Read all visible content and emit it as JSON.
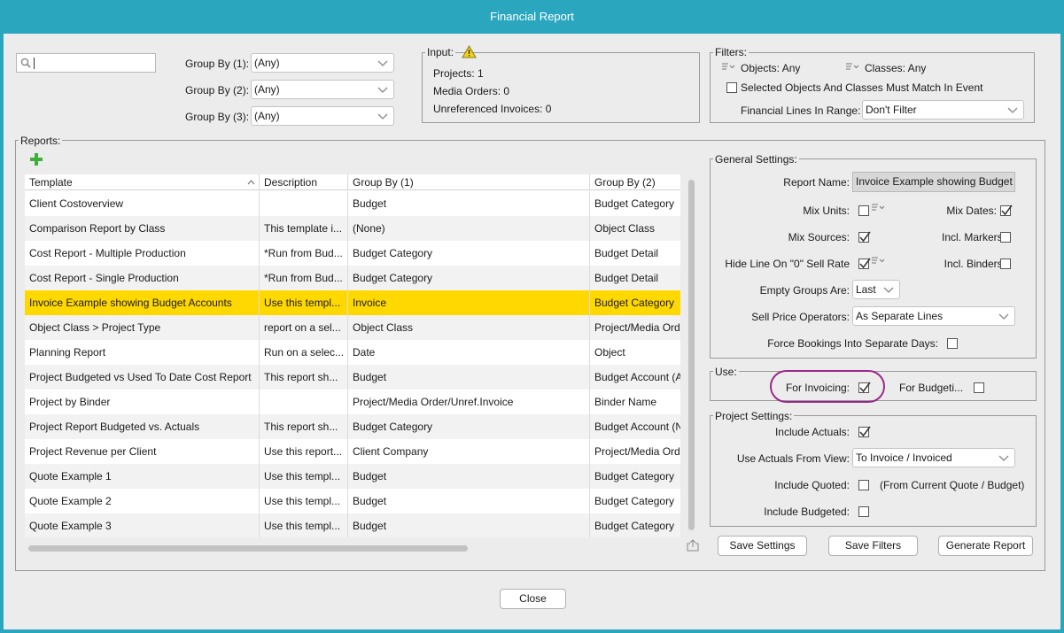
{
  "window": {
    "title": "Financial Report"
  },
  "search": {
    "value": ""
  },
  "group_by": [
    {
      "label": "Group By (1):",
      "value": "(Any)"
    },
    {
      "label": "Group By (2):",
      "value": "(Any)"
    },
    {
      "label": "Group By (3):",
      "value": "(Any)"
    }
  ],
  "input": {
    "title": "Input:",
    "warning_icon": "warning-triangle-icon",
    "projects": "Projects: 1",
    "media_orders": "Media Orders: 0",
    "unreferenced_invoices": "Unreferenced Invoices: 0"
  },
  "filters": {
    "title": "Filters:",
    "objects": "Objects: Any",
    "classes": "Classes: Any",
    "match_label": "Selected Objects And Classes Must Match In Event",
    "match_checked": false,
    "range_label": "Financial Lines In Range:",
    "range_value": "Don't Filter"
  },
  "reports": {
    "title": "Reports:",
    "add_icon": "plus-icon",
    "columns": [
      "Template",
      "Description",
      "Group By (1)",
      "Group By (2)"
    ],
    "rows": [
      [
        "Client Costoverview",
        "",
        "Budget",
        "Budget Category"
      ],
      [
        "Comparison Report by Class",
        "This template i...",
        "(None)",
        "Object Class"
      ],
      [
        "Cost Report - Multiple Production",
        "*Run from Bud...",
        "Budget Category",
        "Budget Detail"
      ],
      [
        "Cost Report - Single Production",
        "*Run from Bud...",
        "Budget Category",
        "Budget Detail"
      ],
      [
        "Invoice Example showing Budget Accounts",
        "Use this templ...",
        "Invoice",
        "Budget Category"
      ],
      [
        "Object Class > Project Type",
        "report on a sel...",
        "Object Class",
        "Project/Media Ord"
      ],
      [
        "Planning Report",
        "Run on a selec...",
        "Date",
        "Object"
      ],
      [
        "Project Budgeted vs Used To Date Cost Report",
        "This report sh...",
        "Budget",
        "Budget Account (A"
      ],
      [
        "Project by Binder",
        "",
        "Project/Media Order/Unref.Invoice",
        "Binder Name"
      ],
      [
        "Project Report Budgeted vs. Actuals",
        "This report sh...",
        "Budget Category",
        "Budget Account (N"
      ],
      [
        "Project Revenue per Client",
        "Use this report...",
        "Client Company",
        "Project/Media Ord"
      ],
      [
        "Quote Example 1",
        "Use this templ...",
        "Budget",
        "Budget Category"
      ],
      [
        "Quote Example 2",
        "Use this templ...",
        "Budget",
        "Budget Category"
      ],
      [
        "Quote Example 3",
        "Use this templ...",
        "Budget",
        "Budget Category"
      ]
    ],
    "selected_index": 4
  },
  "general": {
    "title": "General Settings:",
    "report_name_label": "Report Name:",
    "report_name_value": "Invoice Example showing Budget",
    "mix_units_label": "Mix Units:",
    "mix_units": false,
    "mix_dates_label": "Mix Dates:",
    "mix_dates": true,
    "mix_sources_label": "Mix Sources:",
    "mix_sources": true,
    "incl_markers_label": "Incl. Markers:",
    "incl_markers": false,
    "hide_line_label": "Hide Line On \"0\" Sell Rate",
    "hide_line": true,
    "incl_binders_label": "Incl. Binders:",
    "incl_binders": false,
    "empty_groups_label": "Empty Groups Are:",
    "empty_groups_value": "Last",
    "sell_price_label": "Sell Price Operators:",
    "sell_price_value": "As Separate Lines",
    "force_bookings_label": "Force Bookings Into Separate Days:",
    "force_bookings": false
  },
  "use": {
    "title": "Use:",
    "for_invoicing_label": "For Invoicing:",
    "for_invoicing": true,
    "for_budgeting_label": "For Budgeti...",
    "for_budgeting": false
  },
  "project": {
    "title": "Project Settings:",
    "include_actuals_label": "Include Actuals:",
    "include_actuals": true,
    "actuals_view_label": "Use Actuals From View:",
    "actuals_view_value": "To Invoice / Invoiced",
    "include_quoted_label": "Include Quoted:",
    "include_quoted": false,
    "include_quoted_note": "(From Current Quote / Budget)",
    "include_budgeted_label": "Include Budgeted:",
    "include_budgeted": false
  },
  "buttons": {
    "save_settings": "Save Settings",
    "save_filters": "Save Filters",
    "generate_report": "Generate Report",
    "close": "Close"
  }
}
